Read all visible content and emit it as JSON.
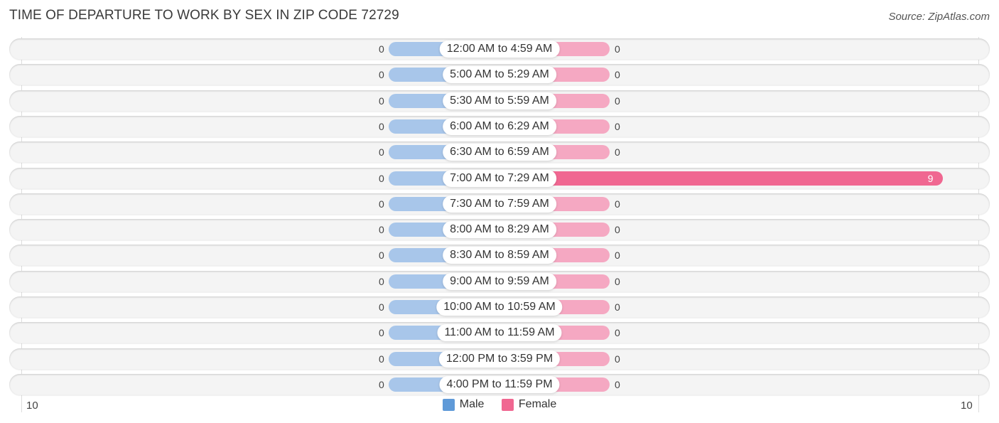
{
  "title": "TIME OF DEPARTURE TO WORK BY SEX IN ZIP CODE 72729",
  "source": "Source: ZipAtlas.com",
  "colors": {
    "male": "#a8c6ea",
    "female": "#f5a8c2",
    "female_highlight": "#f06791",
    "legend_male": "#5f9ad8",
    "legend_female": "#f06791"
  },
  "chart_data": {
    "type": "bar",
    "orientation": "horizontal-diverging",
    "title": "TIME OF DEPARTURE TO WORK BY SEX IN ZIP CODE 72729",
    "categories": [
      "12:00 AM to 4:59 AM",
      "5:00 AM to 5:29 AM",
      "5:30 AM to 5:59 AM",
      "6:00 AM to 6:29 AM",
      "6:30 AM to 6:59 AM",
      "7:00 AM to 7:29 AM",
      "7:30 AM to 7:59 AM",
      "8:00 AM to 8:29 AM",
      "8:30 AM to 8:59 AM",
      "9:00 AM to 9:59 AM",
      "10:00 AM to 10:59 AM",
      "11:00 AM to 11:59 AM",
      "12:00 PM to 3:59 PM",
      "4:00 PM to 11:59 PM"
    ],
    "series": [
      {
        "name": "Male",
        "values": [
          0,
          0,
          0,
          0,
          0,
          0,
          0,
          0,
          0,
          0,
          0,
          0,
          0,
          0
        ]
      },
      {
        "name": "Female",
        "values": [
          0,
          0,
          0,
          0,
          0,
          9,
          0,
          0,
          0,
          0,
          0,
          0,
          0,
          0
        ]
      }
    ],
    "axis": {
      "left_tick": "10",
      "right_tick": "10",
      "range": [
        -10,
        10
      ]
    },
    "legend": [
      "Male",
      "Female"
    ],
    "legend_position": "bottom-center",
    "grid": false
  }
}
